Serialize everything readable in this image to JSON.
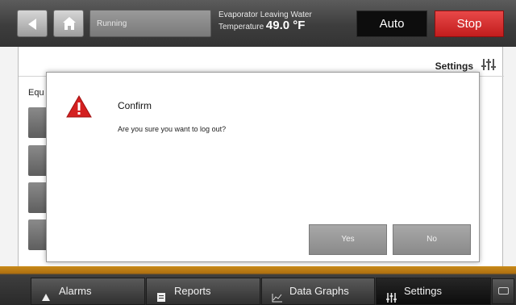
{
  "topbar": {
    "status": "Running",
    "temp_caption_line1": "Evaporator Leaving Water",
    "temp_caption_line2": "Temperature",
    "temp_value": "49.0 °F",
    "auto_label": "Auto",
    "stop_label": "Stop"
  },
  "page": {
    "header_title": "Settings",
    "section_label": "Equ"
  },
  "dialog": {
    "title": "Confirm",
    "message": "Are you sure you want to log out?",
    "yes_label": "Yes",
    "no_label": "No"
  },
  "tabs": [
    {
      "label": "Alarms",
      "icon": "alarm-bell-icon"
    },
    {
      "label": "Reports",
      "icon": "report-document-icon"
    },
    {
      "label": "Data Graphs",
      "icon": "line-graph-icon"
    },
    {
      "label": "Settings",
      "icon": "settings-sliders-icon"
    }
  ],
  "colors": {
    "stop": "#d22c2c",
    "auto": "#0d0d0d",
    "accent_orange": "#c88a1a",
    "warning": "#d42020"
  }
}
